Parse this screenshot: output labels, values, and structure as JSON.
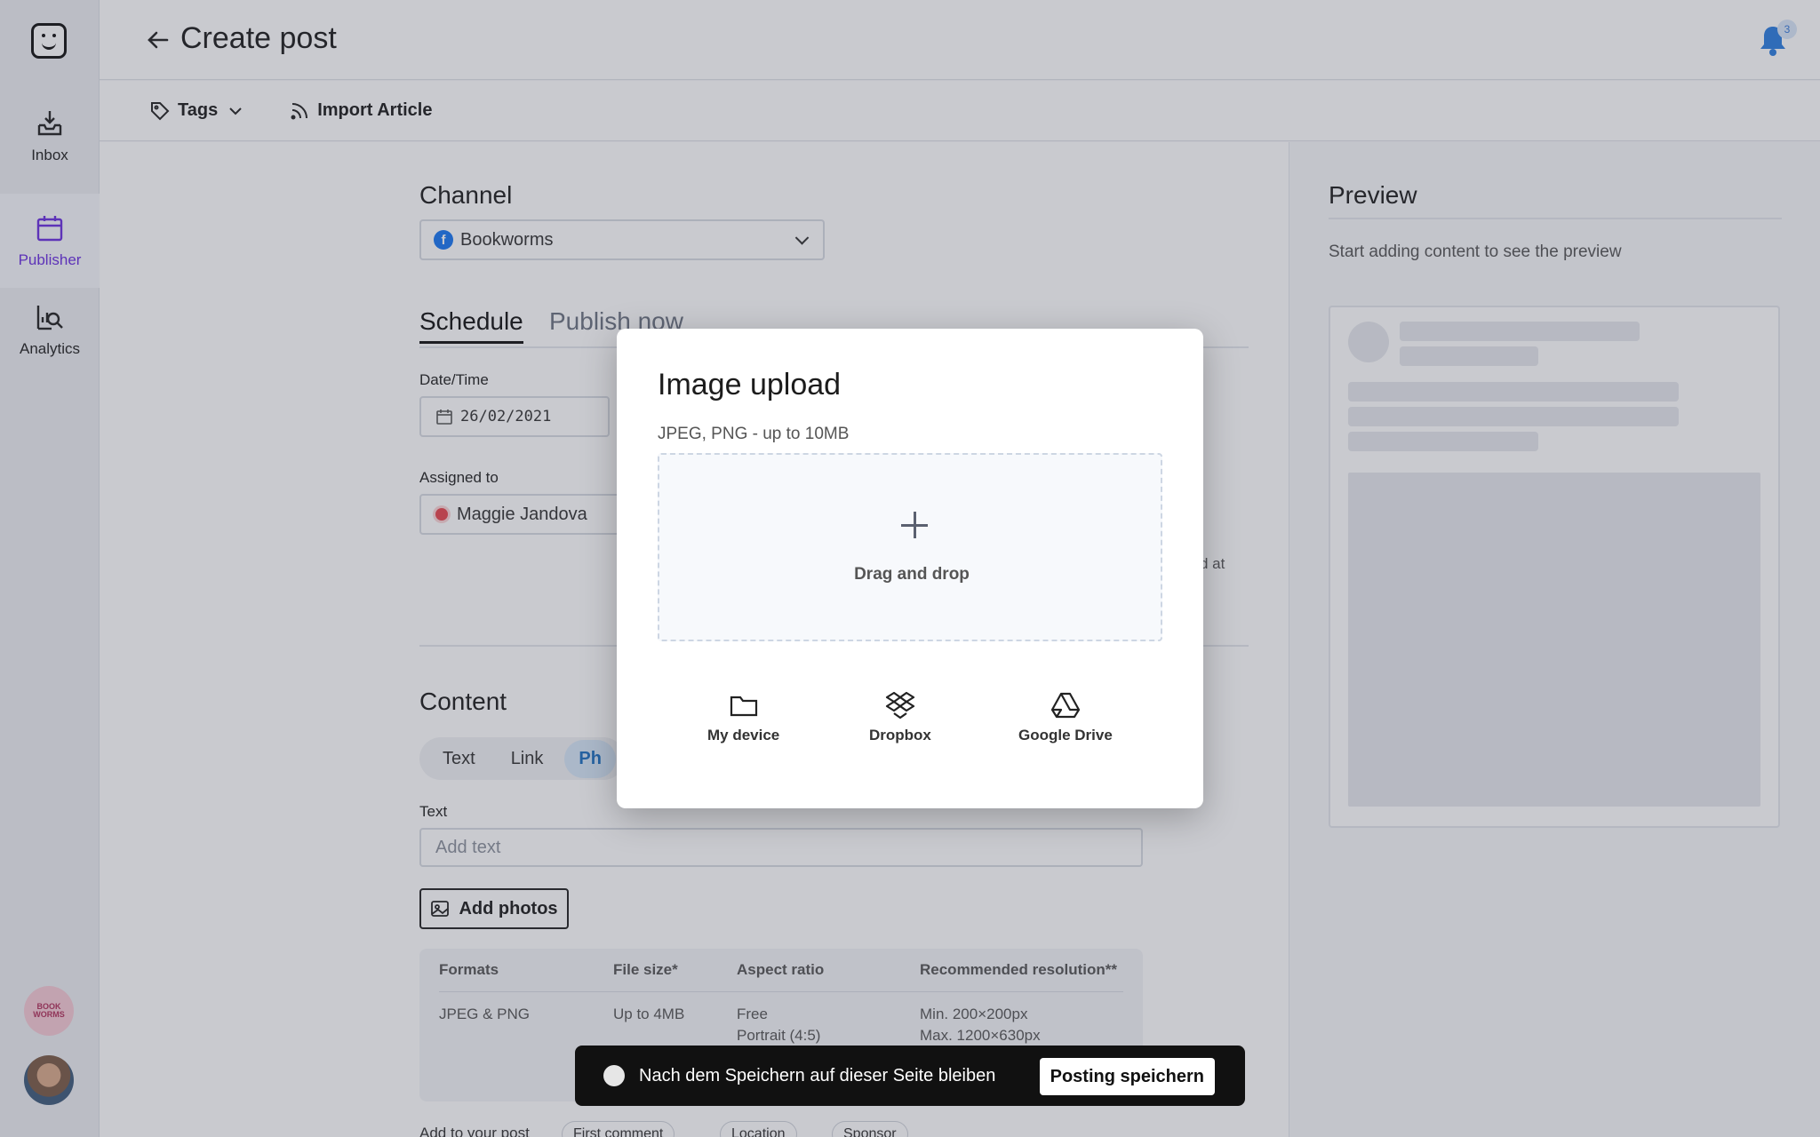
{
  "sidebar": {
    "items": [
      {
        "label": "Inbox",
        "icon": "inbox-icon"
      },
      {
        "label": "Publisher",
        "icon": "calendar-icon"
      },
      {
        "label": "Analytics",
        "icon": "analytics-icon"
      }
    ],
    "brand_avatar_text": "BOOK WORMS",
    "active_color": "#6a2fe0"
  },
  "header": {
    "title": "Create post",
    "notification_count": "3"
  },
  "toolbar": {
    "tags_label": "Tags",
    "import_label": "Import Article"
  },
  "channel": {
    "heading": "Channel",
    "selected": "Bookworms",
    "network_glyph": "f"
  },
  "schedule_tabs": {
    "schedule": "Schedule",
    "publish_now": "Publish now"
  },
  "datetime": {
    "label": "Date/Time",
    "value": "26/02/2021"
  },
  "assigned": {
    "label": "Assigned to",
    "value": "Maggie Jandova"
  },
  "truncated_text": "d at",
  "content": {
    "heading": "Content",
    "segments": [
      "Text",
      "Link",
      "Ph"
    ],
    "text_label": "Text",
    "text_placeholder": "Add text",
    "add_photos_label": "Add photos"
  },
  "formats_table": {
    "headers": [
      "Formats",
      "File size*",
      "Aspect ratio",
      "Recommended resolution**"
    ],
    "row": {
      "format": "JPEG & PNG",
      "size": "Up to 4MB",
      "ratio_1": "Free",
      "ratio_2": "Portrait (4:5)",
      "res_1": "Min. 200×200px",
      "res_2": "Max. 1200×630px"
    }
  },
  "add_to_post": {
    "label": "Add to your post",
    "chips": [
      "First comment",
      "Location",
      "Sponsor"
    ]
  },
  "preview": {
    "title": "Preview",
    "subtitle": "Start adding content to see the preview"
  },
  "modal": {
    "title": "Image upload",
    "subtitle": "JPEG, PNG - up to 10MB",
    "dropzone_text": "Drag and drop",
    "sources": [
      {
        "label": "My device",
        "icon": "folder-icon"
      },
      {
        "label": "Dropbox",
        "icon": "dropbox-icon"
      },
      {
        "label": "Google Drive",
        "icon": "google-drive-icon"
      }
    ]
  },
  "toast": {
    "text": "Nach dem Speichern auf dieser Seite bleiben",
    "button": "Posting speichern"
  }
}
